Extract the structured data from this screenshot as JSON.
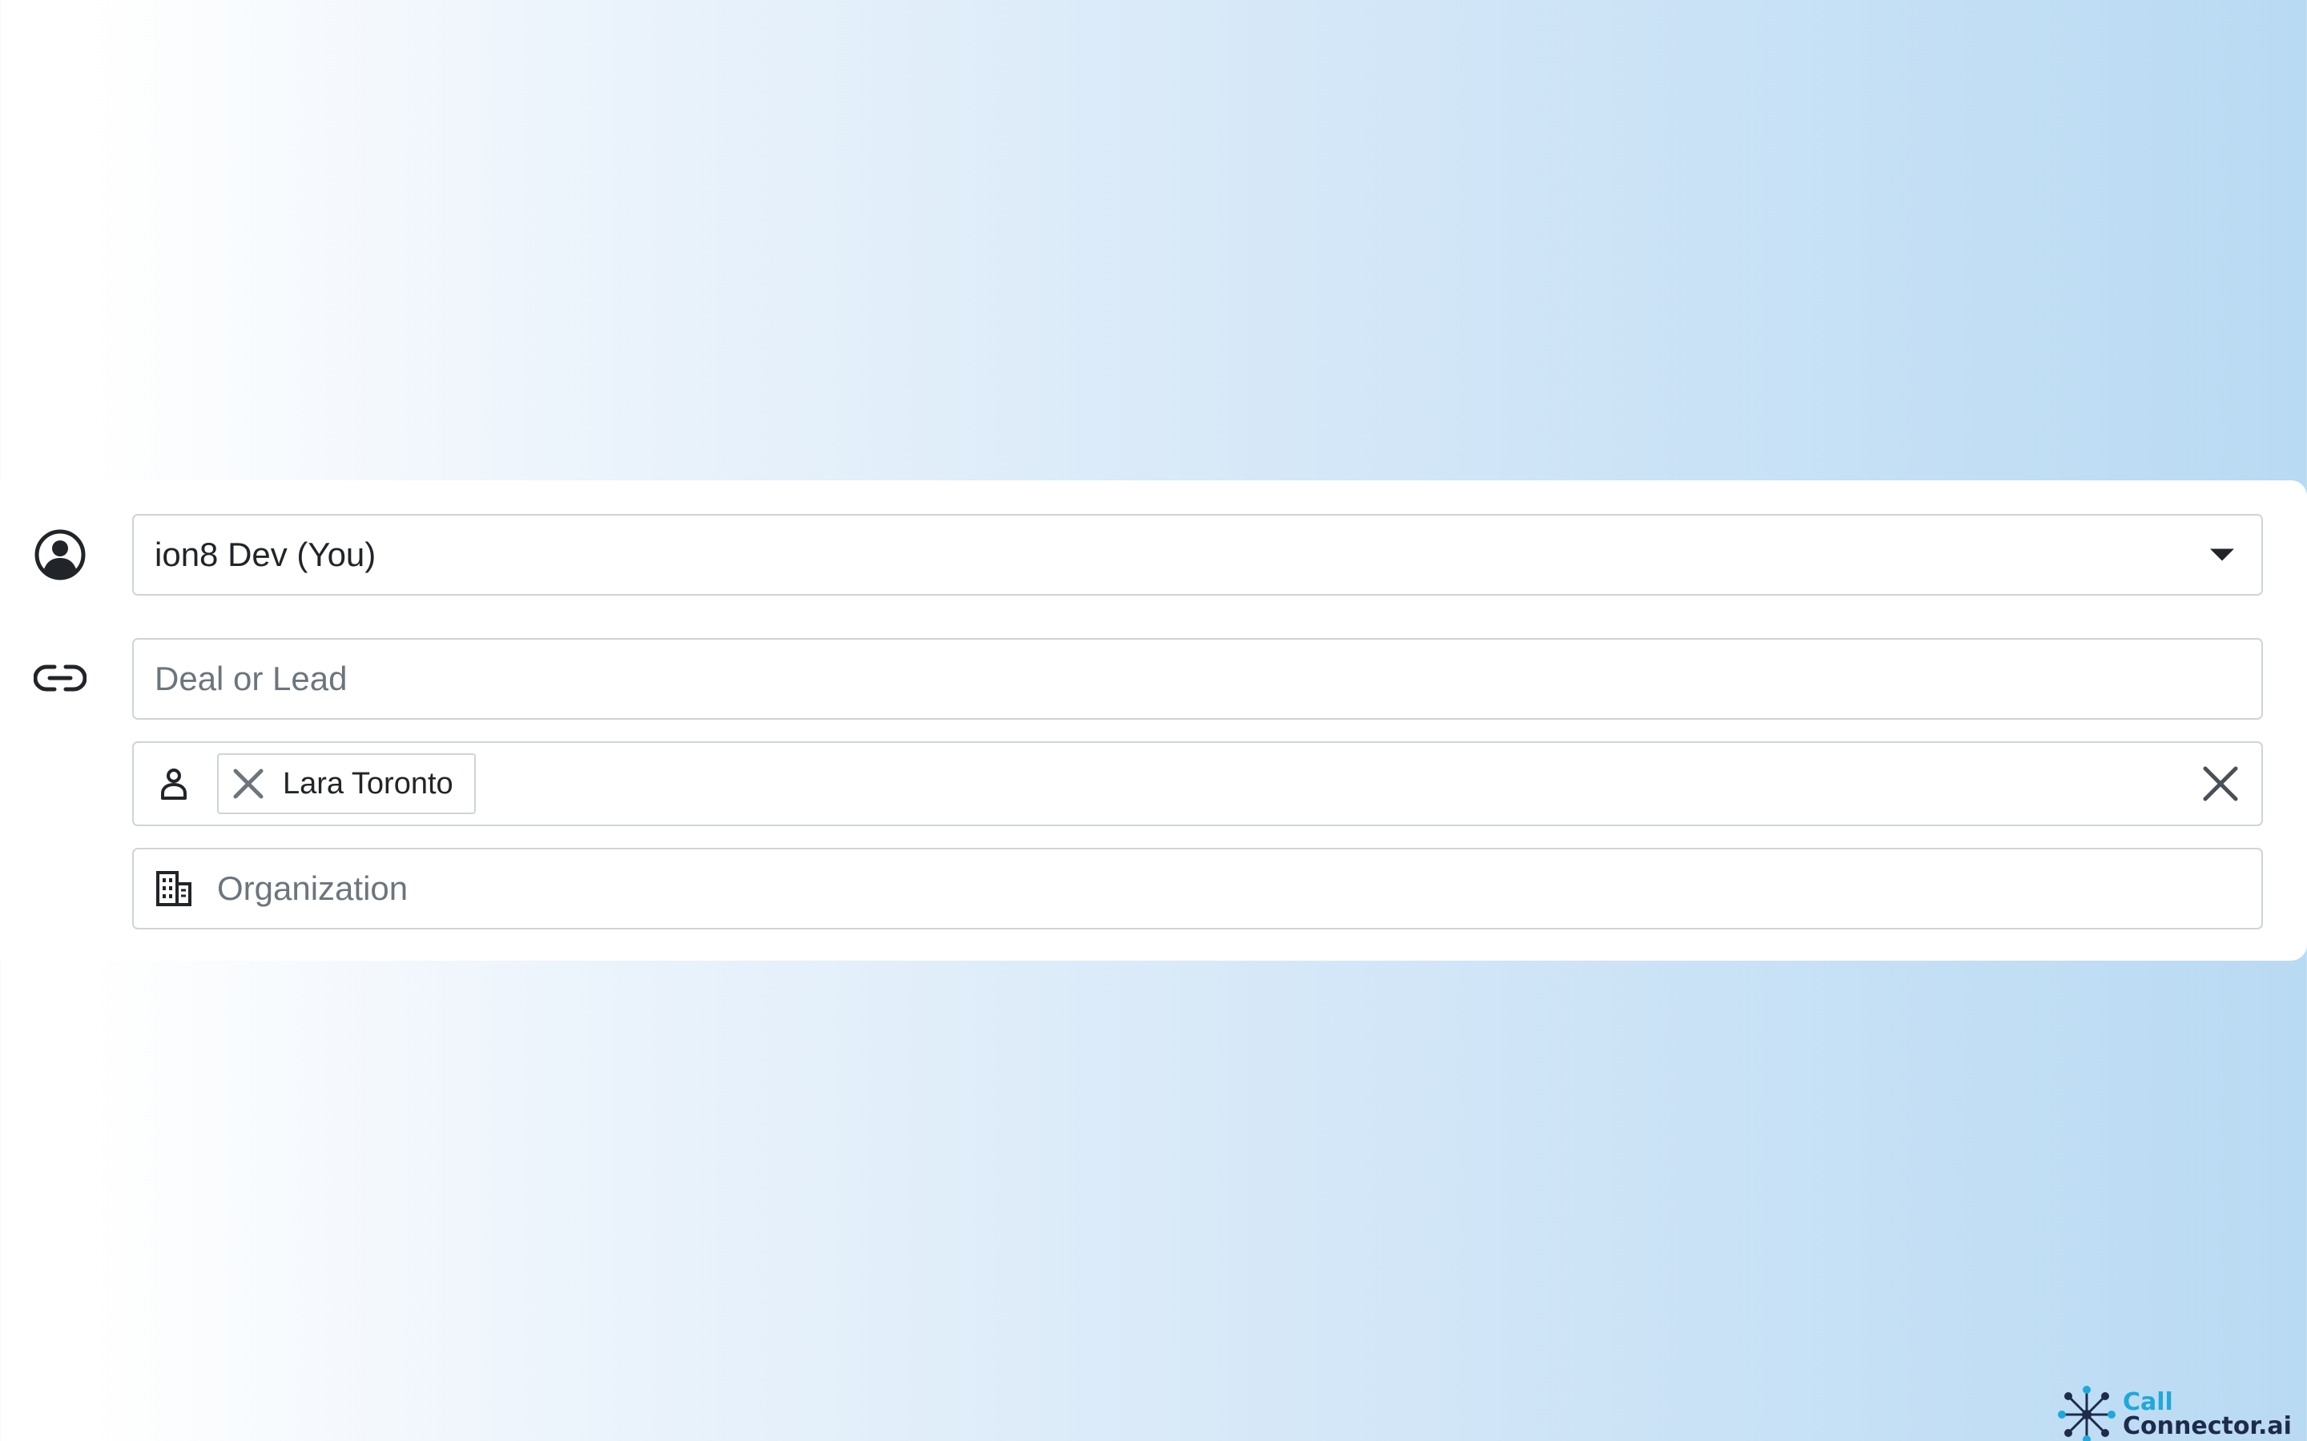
{
  "owner_select": {
    "value": "ion8 Dev (You)",
    "icon": "user-circle-icon"
  },
  "deal_field": {
    "placeholder": "Deal or Lead",
    "icon": "link-icon"
  },
  "person_field": {
    "icon": "person-icon",
    "chips": [
      {
        "label": "Lara Toronto"
      }
    ],
    "clear_icon": "close-icon"
  },
  "organization_field": {
    "placeholder": "Organization",
    "icon": "building-icon"
  },
  "brand": {
    "line1": "Call",
    "line2": "Connector.ai",
    "colors": {
      "primary": "#1fa8d9",
      "secondary": "#1d2b4d"
    }
  }
}
